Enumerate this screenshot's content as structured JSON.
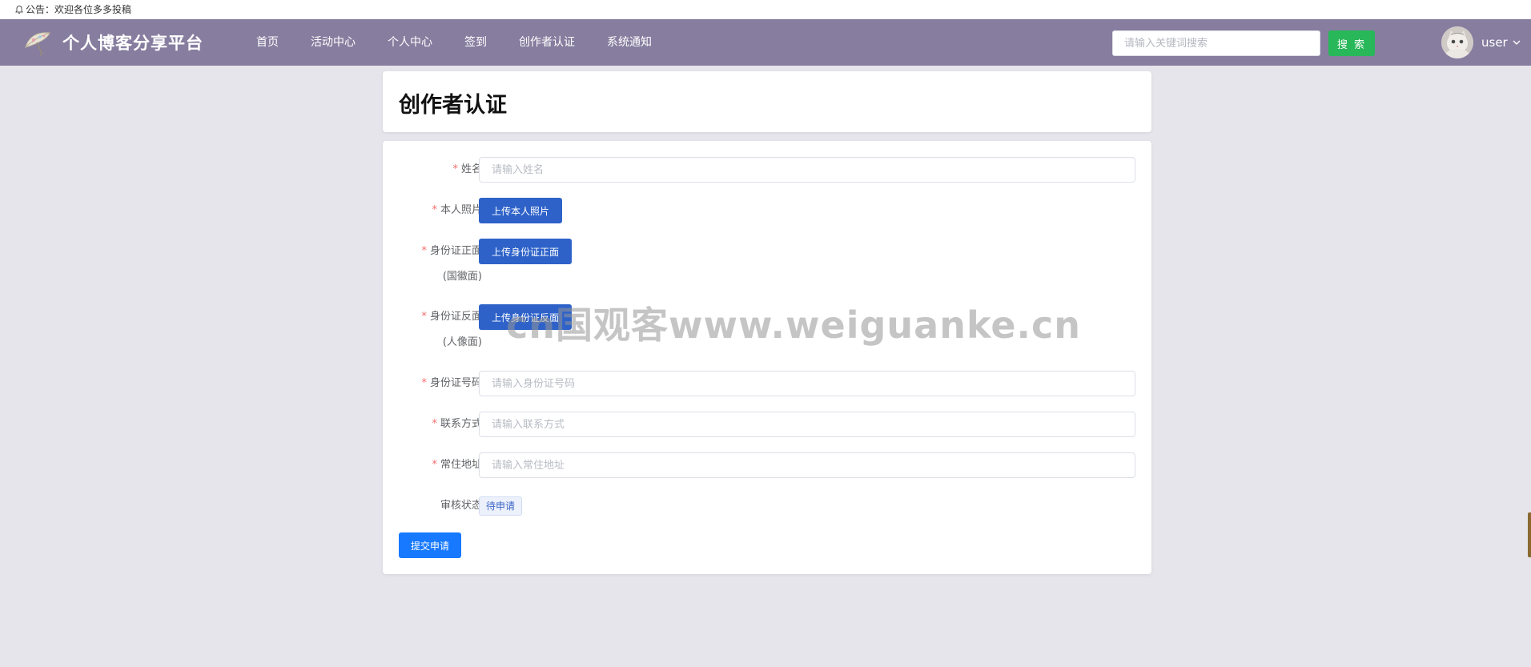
{
  "announcement": {
    "text": "公告：欢迎各位多多投稿"
  },
  "header": {
    "site_title": "个人博客分享平台",
    "nav": [
      {
        "label": "首页"
      },
      {
        "label": "活动中心"
      },
      {
        "label": "个人中心"
      },
      {
        "label": "签到"
      },
      {
        "label": "创作者认证"
      },
      {
        "label": "系统通知"
      }
    ],
    "search": {
      "placeholder": "请输入关键词搜索",
      "button_label": "搜 索"
    },
    "user": {
      "name": "user"
    }
  },
  "page": {
    "title": "创作者认证"
  },
  "form": {
    "required_mark": "*",
    "name": {
      "label": "姓名",
      "placeholder": "请输入姓名"
    },
    "photo": {
      "label": "本人照片",
      "button": "上传本人照片"
    },
    "id_front": {
      "label": "身份证正面",
      "label_sub": "(国徽面)",
      "button": "上传身份证正面"
    },
    "id_back": {
      "label": "身份证反面",
      "label_sub": "(人像面)",
      "button": "上传身份证反面"
    },
    "id_number": {
      "label": "身份证号码",
      "placeholder": "请输入身份证号码"
    },
    "contact": {
      "label": "联系方式",
      "placeholder": "请输入联系方式"
    },
    "address": {
      "label": "常住地址",
      "placeholder": "请输入常住地址"
    },
    "status": {
      "label": "审核状态",
      "value": "待申请"
    },
    "submit_label": "提交申请"
  },
  "watermark": "cn国观客www.weiguanke.cn",
  "colors": {
    "navbar": "#877d9f",
    "background": "#e6e5ec",
    "search_button": "#28b759",
    "upload_button": "#2e62c9",
    "submit_button": "#1779ff",
    "required": "#f56c6c"
  }
}
